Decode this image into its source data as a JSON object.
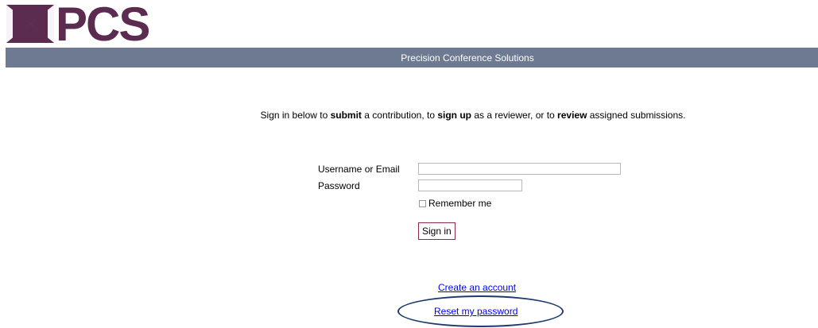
{
  "logo": {
    "text": "PCS"
  },
  "banner": {
    "title": "Precision Conference Solutions"
  },
  "intro": {
    "part1": "Sign in below to ",
    "bold1": "submit",
    "part2": " a contribution, to ",
    "bold2": "sign up",
    "part3": " as a reviewer, or to ",
    "bold3": "review",
    "part4": " assigned submissions."
  },
  "form": {
    "username_label": "Username or Email",
    "username_value": "",
    "password_label": "Password",
    "password_value": "",
    "remember_label": "Remember me",
    "remember_checked": false,
    "signin_label": "Sign in"
  },
  "links": {
    "create_account": "Create an account",
    "reset_password": "Reset my password"
  },
  "colors": {
    "banner_bg": "#6e7a91",
    "logo_purple": "#5b2c4f",
    "link": "#0000ee",
    "signin_border": "#8a2b4a",
    "highlight_ellipse": "#1d3a6e"
  }
}
